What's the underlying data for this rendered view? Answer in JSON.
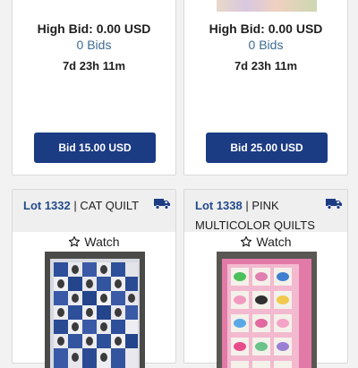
{
  "cards_top": [
    {
      "high_bid": "High Bid: 0.00 USD",
      "bids": "0 Bids",
      "timer": "7d 23h 11m",
      "button": "Bid 15.00 USD"
    },
    {
      "high_bid": "High Bid: 0.00 USD",
      "bids": "0 Bids",
      "timer": "7d 23h 11m",
      "button": "Bid 25.00 USD"
    }
  ],
  "cards_bottom": [
    {
      "lot": "Lot 1332",
      "sep": " | ",
      "title": "CAT QUILT",
      "watch": "Watch"
    },
    {
      "lot": "Lot 1338",
      "sep": " | ",
      "title": "PINK MULTICOLOR QUILTS",
      "watch": "Watch"
    }
  ],
  "colors": {
    "button": "#1b3b83",
    "lot_number": "#244b8a",
    "bids": "#3d6b92",
    "icon": "#1b3b83"
  },
  "icons": {
    "shipping": "truck-icon",
    "watch": "star-outline-icon"
  }
}
